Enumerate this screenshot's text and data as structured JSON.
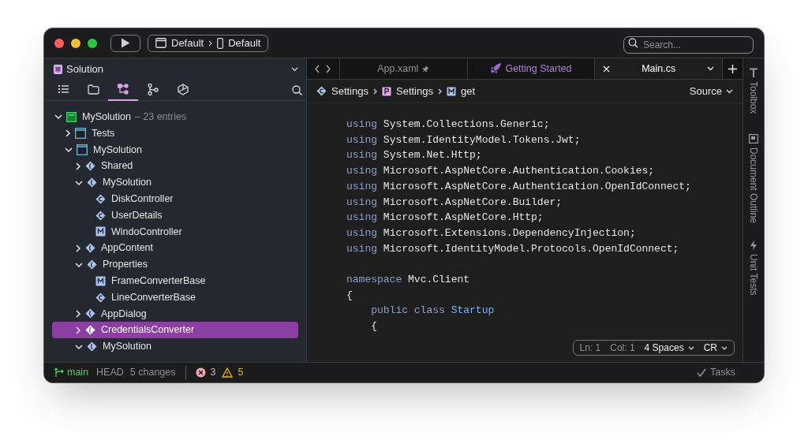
{
  "toolbar": {
    "config": "Default",
    "device": "Default",
    "search": {
      "placeholder": "Search..."
    }
  },
  "sidebar": {
    "title": "Solution",
    "tool_tabs": [
      {
        "kind": "list",
        "selected": false
      },
      {
        "kind": "folder",
        "selected": false
      },
      {
        "kind": "nodes",
        "selected": true
      },
      {
        "kind": "branch",
        "selected": false
      },
      {
        "kind": "unity",
        "selected": false
      }
    ],
    "tree": [
      {
        "kind": "solution",
        "label": "MySolution",
        "note": "– 23 entries",
        "expanded": true,
        "selected": false,
        "children": [
          {
            "kind": "project",
            "label": "Tests",
            "expanded": false,
            "selected": false
          },
          {
            "kind": "project",
            "label": "MySolution",
            "expanded": true,
            "selected": false,
            "children": [
              {
                "kind": "namespace",
                "label": "Shared",
                "expanded": false,
                "selected": false
              },
              {
                "kind": "namespace",
                "label": "MySolution",
                "expanded": true,
                "selected": false,
                "children": [
                  {
                    "kind": "class",
                    "label": "DiskController",
                    "selected": false
                  },
                  {
                    "kind": "class",
                    "label": "UserDetails",
                    "selected": false
                  },
                  {
                    "kind": "module",
                    "label": "WindoController",
                    "selected": false
                  }
                ]
              },
              {
                "kind": "namespace",
                "label": "AppContent",
                "expanded": false,
                "selected": false
              },
              {
                "kind": "namespace",
                "label": "Properties",
                "expanded": true,
                "selected": false,
                "children": [
                  {
                    "kind": "module",
                    "label": "FrameConverterBase",
                    "selected": false
                  },
                  {
                    "kind": "class",
                    "label": "LineConverterBase",
                    "selected": false
                  }
                ]
              },
              {
                "kind": "namespace",
                "label": "AppDialog",
                "expanded": false,
                "selected": false
              },
              {
                "kind": "namespace",
                "label": "CredentialsConverter",
                "expanded": false,
                "selected": true
              },
              {
                "kind": "namespace",
                "label": "MySolution",
                "expanded": true,
                "selected": false
              }
            ]
          }
        ]
      }
    ]
  },
  "tabs": [
    {
      "label": "App.xaml",
      "kind": "pinned",
      "selected": false
    },
    {
      "label": "Getting Started",
      "kind": "start",
      "selected": false
    },
    {
      "label": "Main.cs",
      "kind": "file",
      "selected": true
    }
  ],
  "breadcrumb": [
    {
      "kind": "class",
      "label": "Settings"
    },
    {
      "kind": "property",
      "label": "Settings"
    },
    {
      "kind": "method",
      "label": "get"
    }
  ],
  "view_mode": "Source",
  "code": [
    {
      "indented": false,
      "gap_before": false,
      "tokens": [
        {
          "kind": "keyword",
          "text": "using"
        },
        {
          "kind": "plain",
          "text": "System.Collections.Generic;"
        }
      ]
    },
    {
      "indented": false,
      "gap_before": false,
      "tokens": [
        {
          "kind": "keyword",
          "text": "using"
        },
        {
          "kind": "plain",
          "text": "System.IdentityModel.Tokens.Jwt;"
        }
      ]
    },
    {
      "indented": false,
      "gap_before": false,
      "tokens": [
        {
          "kind": "keyword",
          "text": "using"
        },
        {
          "kind": "plain",
          "text": "System.Net.Http;"
        }
      ]
    },
    {
      "indented": false,
      "gap_before": false,
      "tokens": [
        {
          "kind": "keyword",
          "text": "using"
        },
        {
          "kind": "plain",
          "text": "Microsoft.AspNetCore.Authentication.Cookies;"
        }
      ]
    },
    {
      "indented": false,
      "gap_before": false,
      "tokens": [
        {
          "kind": "keyword",
          "text": "using"
        },
        {
          "kind": "plain",
          "text": "Microsoft.AspNetCore.Authentication.OpenIdConnect;"
        }
      ]
    },
    {
      "indented": false,
      "gap_before": false,
      "tokens": [
        {
          "kind": "keyword",
          "text": "using"
        },
        {
          "kind": "plain",
          "text": "Microsoft.AspNetCore.Builder;"
        }
      ]
    },
    {
      "indented": false,
      "gap_before": false,
      "tokens": [
        {
          "kind": "keyword",
          "text": "using"
        },
        {
          "kind": "plain",
          "text": "Microsoft.AspNetCore.Http;"
        }
      ]
    },
    {
      "indented": false,
      "gap_before": false,
      "tokens": [
        {
          "kind": "keyword",
          "text": "using"
        },
        {
          "kind": "plain",
          "text": "Microsoft.Extensions.DependencyInjection;"
        }
      ]
    },
    {
      "indented": false,
      "gap_before": false,
      "tokens": [
        {
          "kind": "keyword",
          "text": "using"
        },
        {
          "kind": "plain",
          "text": "Microsoft.IdentityModel.Protocols.OpenIdConnect;"
        }
      ]
    },
    {
      "indented": false,
      "gap_before": true,
      "tokens": [
        {
          "kind": "keyword",
          "text": "namespace"
        },
        {
          "kind": "plain",
          "text": "Mvc.Client"
        }
      ]
    },
    {
      "indented": false,
      "gap_before": false,
      "tokens": [
        {
          "kind": "plain",
          "text": "{"
        }
      ]
    },
    {
      "indented": true,
      "gap_before": false,
      "tokens": [
        {
          "kind": "keyword",
          "text": "public class"
        },
        {
          "kind": "type",
          "text": "Startup"
        }
      ]
    },
    {
      "indented": true,
      "gap_before": false,
      "tokens": [
        {
          "kind": "plain",
          "text": "{"
        }
      ]
    }
  ],
  "editor_status": {
    "line": "Ln: 1",
    "column": "Col: 1",
    "indent": "4 Spaces",
    "line_ending": "CR"
  },
  "side_panels": [
    {
      "kind": "toolbox",
      "label": "Toolbox"
    },
    {
      "kind": "outline",
      "label": "Document Outline"
    },
    {
      "kind": "tests",
      "label": "Unit Tests"
    }
  ],
  "status_bar": {
    "branch": "main",
    "head": "HEAD",
    "changes": "5 changes",
    "errors": "3",
    "warnings": "5",
    "tasks": "Tasks"
  }
}
